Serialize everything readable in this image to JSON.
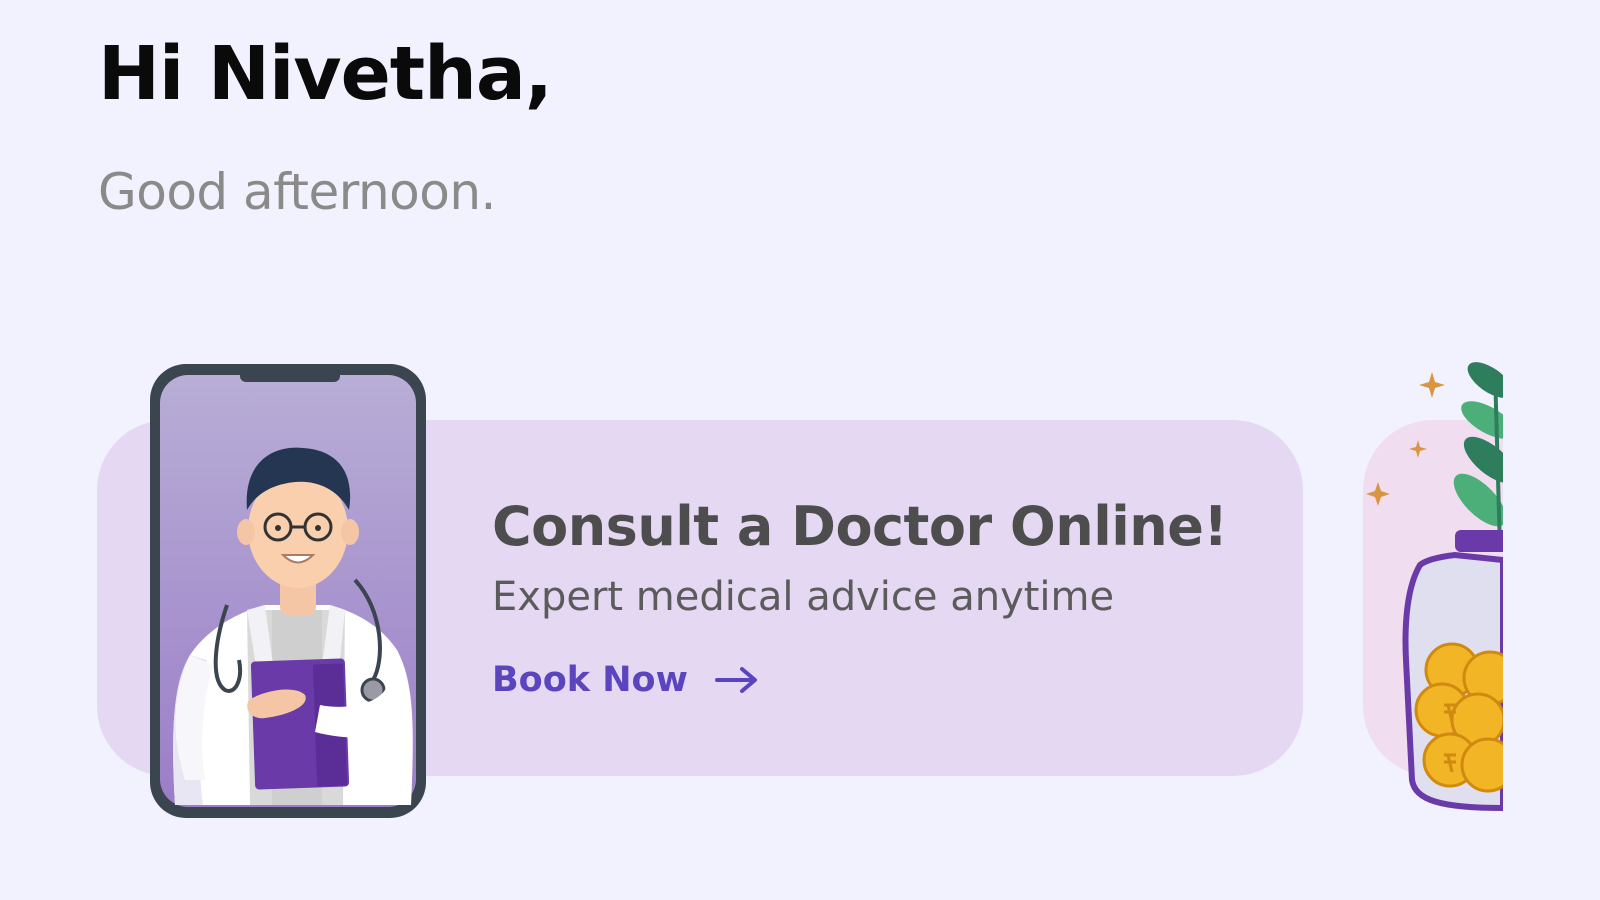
{
  "greeting": {
    "title": "Hi Nivetha,",
    "subtitle": "Good afternoon."
  },
  "carousel": {
    "cards": [
      {
        "title": "Consult a Doctor Online!",
        "description": "Expert medical advice anytime",
        "cta_label": "Book Now",
        "cta_icon": "arrow-right-icon",
        "illustration": "doctor-on-phone-illustration",
        "background": "#e5d8f3",
        "cta_color": "#5b45bf"
      },
      {
        "illustration": "coin-jar-plant-illustration",
        "background": "#f0ddef"
      }
    ]
  },
  "colors": {
    "page_background": "#f2f1fe",
    "accent": "#6a3aa8",
    "title_text": "#0a0a0a",
    "subtitle_text": "#8a8a8a"
  }
}
